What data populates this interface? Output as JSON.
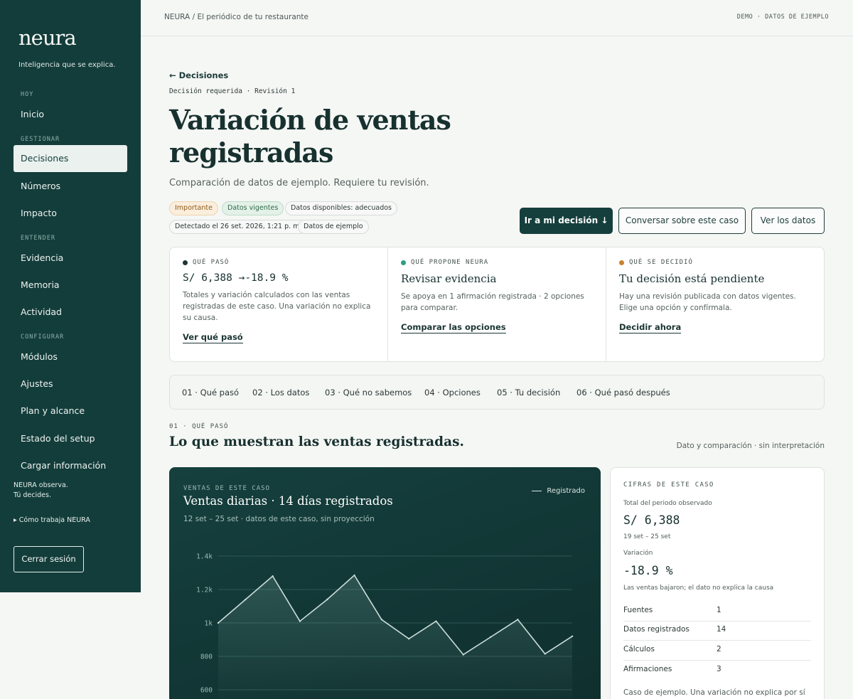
{
  "sidebar": {
    "logo": "neura",
    "tagline": "Inteligencia que se explica.",
    "sections": [
      {
        "label": "HOY",
        "items": [
          "Inicio"
        ]
      },
      {
        "label": "GESTIONAR",
        "items": [
          "Decisiones",
          "Números",
          "Impacto"
        ]
      },
      {
        "label": "ENTENDER",
        "items": [
          "Evidencia",
          "Memoria",
          "Actividad"
        ]
      },
      {
        "label": "CONFIGURAR",
        "items": [
          "Módulos",
          "Ajustes",
          "Plan y alcance",
          "Estado del setup",
          "Cargar información"
        ]
      }
    ],
    "active_item": "Decisiones",
    "note_line1": "NEURA observa.",
    "note_line2": "Tú decides.",
    "how_link": "▸ Cómo trabaja NEURA",
    "logout": "Cerrar sesión"
  },
  "topbar": {
    "breadcrumb": "NEURA / El periódico de tu restaurante",
    "demo": "DEMO · DATOS DE EJEMPLO"
  },
  "header": {
    "back": "← Decisiones",
    "kicker": "Decisión requerida · Revisión 1",
    "title": "Variación de ventas registradas",
    "subtitle": "Comparación de datos de ejemplo. Requiere tu revisión."
  },
  "tags": {
    "important": "Importante",
    "current": "Datos vigentes",
    "available": "Datos disponibles: adecuados",
    "detected": "Detectado el 26 set. 2026, 1:21 p. m.",
    "example": "Datos de ejemplo"
  },
  "actions": {
    "go_decision": "Ir a mi decisión ↓",
    "chat": "Conversar sobre este caso",
    "view_data": "Ver los datos"
  },
  "cards": [
    {
      "heading": "QUÉ PASÓ",
      "dot": "#1c3533",
      "value": "S/ 6,388",
      "arrow": "→",
      "change": "-18.9 %",
      "text": "Totales y variación calculados con las ventas registradas de este caso. Una variación no explica su causa.",
      "link": "Ver qué pasó"
    },
    {
      "heading": "QUÉ PROPONE NEURA",
      "dot": "#2a9d86",
      "title": "Revisar evidencia",
      "text": "Se apoya en 1 afirmación registrada · 2 opciones para comparar.",
      "link": "Comparar las opciones"
    },
    {
      "heading": "QUÉ SE DECIDIÓ",
      "dot": "#c8822c",
      "title": "Tu decisión está pendiente",
      "text": "Hay una revisión publicada con datos vigentes. Elige una opción y confírmala.",
      "link": "Decidir ahora"
    }
  ],
  "steps": [
    "01 · Qué pasó",
    "02 · Los datos",
    "03 · Qué no sabemos",
    "04 · Opciones",
    "05 · Tu decisión",
    "06 · Qué pasó después"
  ],
  "section": {
    "kicker": "01 · QUÉ PASÓ",
    "title": "Lo que muestran las ventas registradas.",
    "right": "Dato y comparación · sin interpretación"
  },
  "chart_panel": {
    "kicker": "VENTAS DE ESTE CASO",
    "title": "Ventas diarias · 14 días registrados",
    "subtitle": "12 set – 25 set · datos de este caso, sin proyección",
    "legend": "Registrado"
  },
  "chart_data": {
    "type": "area",
    "series": [
      {
        "name": "Registrado",
        "values": [
          1000,
          1140,
          1280,
          1010,
          1140,
          1285,
          1020,
          905,
          1010,
          810,
          915,
          1020,
          815,
          920
        ]
      }
    ],
    "y_ticks": [
      "600",
      "800",
      "1k",
      "1.2k",
      "1.4k"
    ],
    "y_tick_values": [
      600,
      800,
      1000,
      1200,
      1400
    ],
    "ylim": [
      200,
      1400
    ],
    "grid": true,
    "colors": {
      "line": "#c9ddd8",
      "grid": "#2c5654",
      "tick": "#9cbab5"
    }
  },
  "figures": {
    "heading": "CIFRAS DE ESTE CASO",
    "total_label": "Total del periodo observado",
    "total_value": "S/ 6,388",
    "total_range": "19 set – 25 set",
    "var_label": "Variación",
    "var_value": "-18.9 %",
    "var_note": "Las ventas bajaron; el dato no explica la causa",
    "rows": [
      {
        "label": "Fuentes",
        "value": "1"
      },
      {
        "label": "Datos registrados",
        "value": "14"
      },
      {
        "label": "Cálculos",
        "value": "2"
      },
      {
        "label": "Afirmaciones",
        "value": "3"
      }
    ],
    "footer": "Caso de ejemplo. Una variación no explica por sí"
  }
}
